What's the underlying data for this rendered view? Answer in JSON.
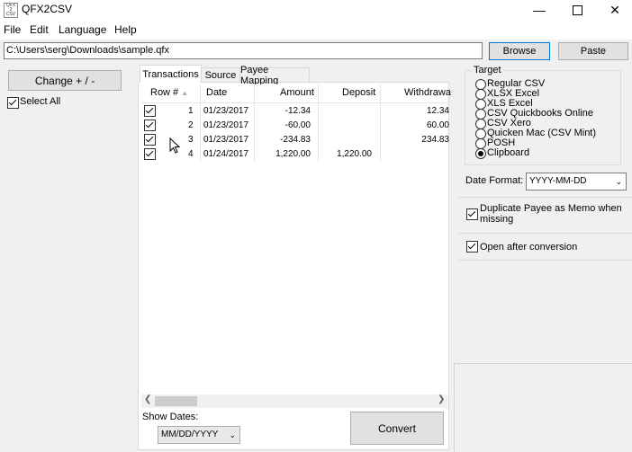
{
  "window": {
    "title": "QFX2CSV",
    "icon_text": "QFX2CSV"
  },
  "menu": [
    "File",
    "Edit",
    "Language",
    "Help"
  ],
  "file_path": "C:\\Users\\serg\\Downloads\\sample.qfx",
  "buttons": {
    "browse": "Browse",
    "paste": "Paste",
    "change": "Change + / -",
    "convert": "Convert"
  },
  "select_all": "Select All",
  "tabs": [
    "Transactions",
    "Source",
    "Payee Mapping"
  ],
  "grid": {
    "headers": [
      "Row #",
      "Date",
      "Amount",
      "Deposit",
      "Withdrawa"
    ],
    "rows": [
      {
        "row": "1",
        "date": "01/23/2017",
        "amount": "-12.34",
        "deposit": "",
        "withdrawal": "12.34"
      },
      {
        "row": "2",
        "date": "01/23/2017",
        "amount": "-60.00",
        "deposit": "",
        "withdrawal": "60.00"
      },
      {
        "row": "3",
        "date": "01/23/2017",
        "amount": "-234.83",
        "deposit": "",
        "withdrawal": "234.83"
      },
      {
        "row": "4",
        "date": "01/24/2017",
        "amount": "1,220.00",
        "deposit": "1,220.00",
        "withdrawal": ""
      }
    ]
  },
  "show_dates": {
    "label": "Show Dates:",
    "value": "MM/DD/YYYY"
  },
  "target": {
    "legend": "Target",
    "options": [
      "Regular CSV",
      "XLSX Excel",
      "XLS Excel",
      "CSV Quickbooks Online",
      "CSV Xero",
      "Quicken Mac (CSV Mint)",
      "POSH",
      "Clipboard"
    ],
    "selected": "Clipboard"
  },
  "date_format": {
    "label": "Date Format:",
    "value": "YYYY-MM-DD"
  },
  "options": {
    "duplicate_payee": "Duplicate Payee as Memo when missing",
    "open_after": "Open after conversion"
  }
}
